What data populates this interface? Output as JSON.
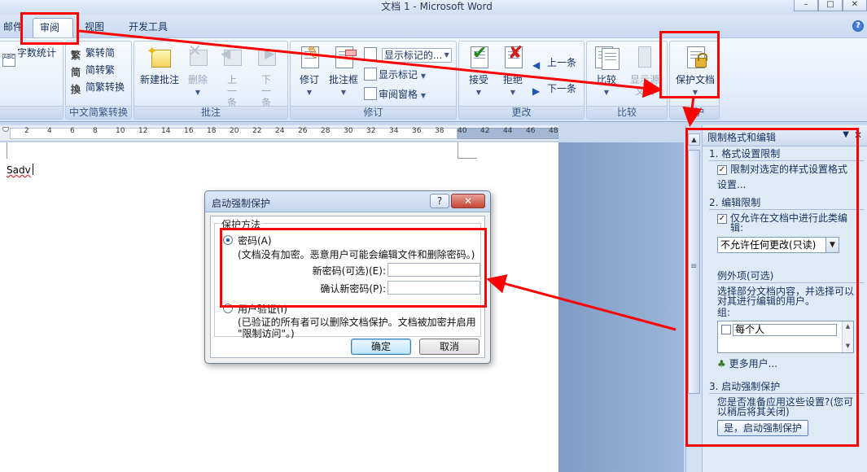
{
  "window": {
    "title": "文档 1 - Microsoft Word",
    "buttons": [
      "–",
      "□",
      "✕"
    ]
  },
  "tabs": [
    {
      "label": "邮件",
      "active": false
    },
    {
      "label": "审阅",
      "active": true
    },
    {
      "label": "视图",
      "active": false
    },
    {
      "label": "开发工具",
      "active": false
    }
  ],
  "ribbon": {
    "proofing": {
      "word_count": "字数统计"
    },
    "chinese": {
      "label": "中文简繁转换",
      "to_simplified": "繁转简",
      "to_traditional": "简转繁",
      "convert": "简繁转换"
    },
    "comments": {
      "label": "批注",
      "new": "新建批注",
      "delete": "删除",
      "prev": "上一条",
      "next": "下一条"
    },
    "tracking": {
      "label": "修订",
      "track": "修订",
      "balloon": "批注框",
      "display": "显示标记的...",
      "show_markup": "显示标记",
      "review_pane": "审阅窗格"
    },
    "changes": {
      "label": "更改",
      "accept": "接受",
      "reject": "拒绝",
      "prev": "上一条",
      "next": "下一条"
    },
    "compare": {
      "label": "比较",
      "compare": "比较",
      "show_source": "显示源文档"
    },
    "protect": {
      "label": "保护",
      "protect_doc": "保护文档"
    }
  },
  "ruler": {
    "ticks": [
      "2",
      "4",
      "6",
      "8",
      "10",
      "12",
      "14",
      "16",
      "18",
      "20",
      "22",
      "24",
      "26",
      "28",
      "30",
      "32",
      "34",
      "36",
      "38",
      "40",
      "42",
      "44",
      "46",
      "48"
    ]
  },
  "document": {
    "text": "Sadv"
  },
  "dialog": {
    "title": "启动强制保护",
    "help": "?",
    "close": "✕",
    "group_label": "保护方法",
    "password_option": "密码(A)",
    "password_note": "(文档没有加密。恶意用户可能会编辑文件和删除密码。)",
    "new_password_label": "新密码(可选)(E):",
    "confirm_password_label": "确认新密码(P):",
    "new_password_value": "",
    "confirm_password_value": "",
    "user_auth_option": "用户验证(I)",
    "user_auth_note_1": "(已验证的所有者可以删除文档保护。文档被加密并启用",
    "user_auth_note_2": "\"限制访问\"。)",
    "ok": "确定",
    "cancel": "取消"
  },
  "task_pane": {
    "title": "限制格式和编辑",
    "section1_title": "1. 格式设置限制",
    "section1_checkbox": "限制对选定的样式设置格式",
    "section1_link": "设置...",
    "section2_title": "2. 编辑限制",
    "section2_checkbox_1": "仅允许在文档中进行此类编",
    "section2_checkbox_2": "辑:",
    "edit_type_value": "不允许任何更改(只读)",
    "exceptions_title": "例外项(可选)",
    "exceptions_desc_1": "选择部分文档内容，并选择可以",
    "exceptions_desc_2": "对其进行编辑的用户。",
    "group_label": "组:",
    "everyone": "每个人",
    "more_users": "更多用户...",
    "section3_title": "3. 启动强制保护",
    "section3_desc_1": "您是否准备应用这些设置?(您可",
    "section3_desc_2": "以稍后将其关闭)",
    "start_button": "是，启动强制保护"
  },
  "colors": {
    "annotation": "#ff0000",
    "ribbon_bg": "#e5eefa",
    "accent": "#15325f"
  }
}
